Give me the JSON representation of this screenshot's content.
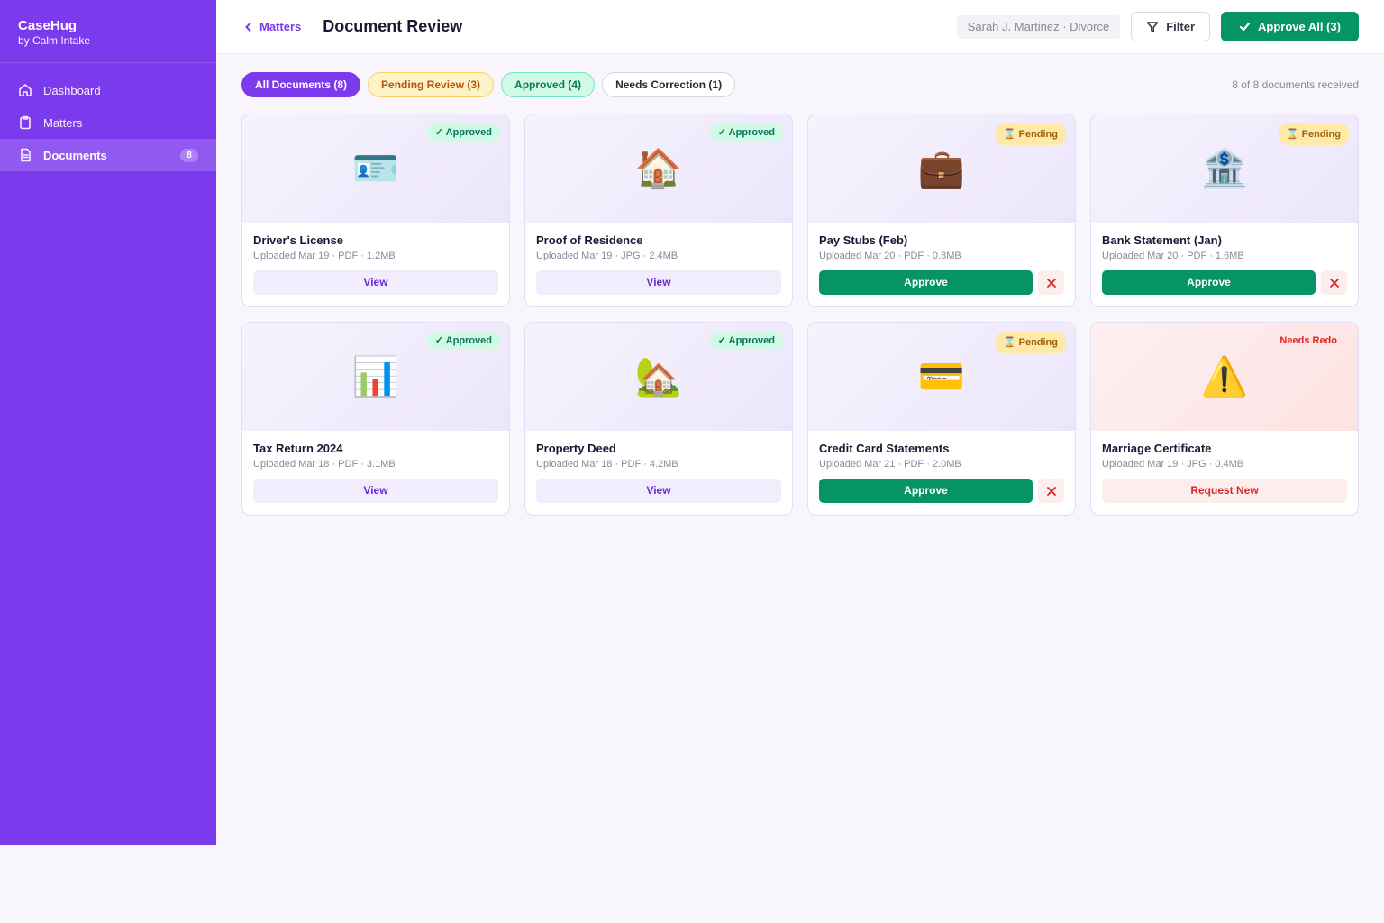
{
  "sidebar": {
    "brand_name": "CaseHug",
    "brand_sub": "by Calm Intake",
    "items": [
      {
        "label": "Dashboard",
        "icon": "home-icon"
      },
      {
        "label": "Matters",
        "icon": "clipboard-icon"
      },
      {
        "label": "Documents",
        "icon": "document-icon",
        "badge": "8",
        "active": true
      }
    ]
  },
  "header": {
    "back_label": "Matters",
    "title": "Document Review",
    "client": "Sarah J. Martinez · Divorce",
    "filter_label": "Filter",
    "approve_all_label": "Approve All (3)"
  },
  "tabs": {
    "all": "All Documents (8)",
    "pending": "Pending Review (3)",
    "approved": "Approved (4)",
    "correction": "Needs Correction (1)"
  },
  "received": "8 of 8 documents received",
  "documents": [
    {
      "title": "Driver's License",
      "meta": "Uploaded Mar 19 · PDF · 1.2MB",
      "status": "✓ Approved",
      "emoji": "🪪",
      "action": "View"
    },
    {
      "title": "Proof of Residence",
      "meta": "Uploaded Mar 19 · JPG · 2.4MB",
      "status": "✓ Approved",
      "emoji": "🏠",
      "action": "View"
    },
    {
      "title": "Pay Stubs (Feb)",
      "meta": "Uploaded Mar 20 · PDF · 0.8MB",
      "status": "⌛ Pending",
      "emoji": "💼",
      "action": "Approve"
    },
    {
      "title": "Bank Statement (Jan)",
      "meta": "Uploaded Mar 20 · PDF · 1.6MB",
      "status": "⌛ Pending",
      "emoji": "🏦",
      "action": "Approve"
    },
    {
      "title": "Tax Return 2024",
      "meta": "Uploaded Mar 18 · PDF · 3.1MB",
      "status": "✓ Approved",
      "emoji": "📊",
      "action": "View"
    },
    {
      "title": "Property Deed",
      "meta": "Uploaded Mar 18 · PDF · 4.2MB",
      "status": "✓ Approved",
      "emoji": "🏡",
      "action": "View"
    },
    {
      "title": "Credit Card Statements",
      "meta": "Uploaded Mar 21 · PDF · 2.0MB",
      "status": "⌛ Pending",
      "emoji": "💳",
      "action": "Approve"
    },
    {
      "title": "Marriage Certificate",
      "meta": "Uploaded Mar 19 · JPG · 0.4MB",
      "status": "Needs Redo",
      "emoji": "⚠️",
      "action": "Request New"
    }
  ],
  "colors": {
    "brand": "#7c3aed",
    "approve": "#069467",
    "danger": "#dc2626",
    "pending": "#b45309"
  }
}
